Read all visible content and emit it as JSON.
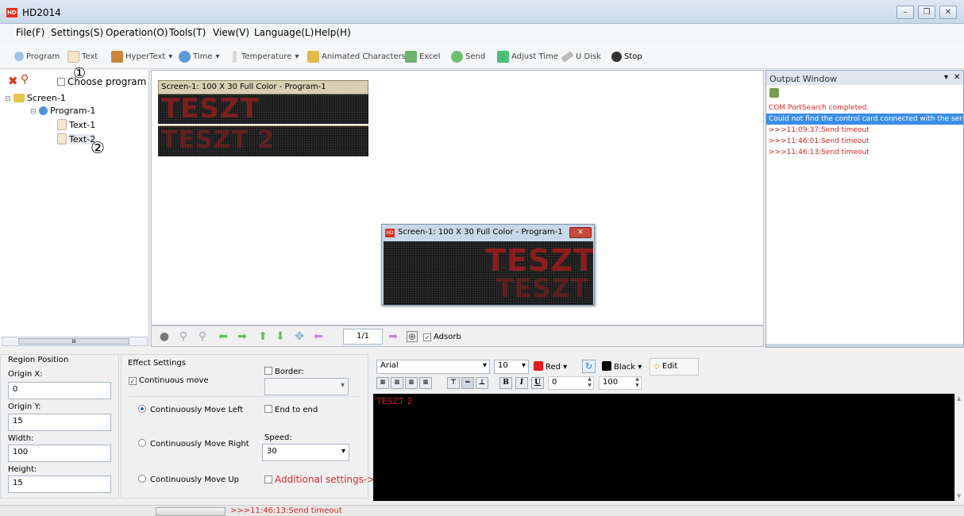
{
  "app": {
    "title": "HD2014"
  },
  "menu": [
    "File(F)",
    "Settings(S)",
    "Operation(O)",
    "Tools(T)",
    "View(V)",
    "Language(L)",
    "Help(H)"
  ],
  "toolbar": {
    "program": "Program",
    "text": "Text",
    "hypertext": "HyperText",
    "time": "Time",
    "temperature": "Temperature",
    "animated": "Animated Characters",
    "excel": "Excel",
    "send": "Send",
    "adjust_time": "Adjust Time",
    "udisk": "U Disk",
    "stop": "Stop"
  },
  "tree": {
    "choose_program": "Choose program",
    "screen": "Screen-1",
    "program": "Program-1",
    "text1": "Text-1",
    "text2": "Text-2",
    "marker1": "①",
    "marker2": "②",
    "scroll_mark": "III"
  },
  "canvas": {
    "screen_title": "Screen-1: 100 X 30 Full Color - Program-1",
    "led1": "TESZT",
    "led2": "TESZT 2",
    "preview_title": "Screen-1: 100 X 30 Full Color - Program-1",
    "page": "1/1",
    "adsorb": "Adsorb"
  },
  "output": {
    "title": "Output Window",
    "lines": [
      "COM PortSearch completed.",
      "Could not find the control card connected with the serial p",
      ">>>11:09:37:Send timeout",
      ">>>11:46:01:Send timeout",
      ">>>11:46:13:Send timeout"
    ]
  },
  "region": {
    "title": "Region Position",
    "origin_x_label": "Origin X:",
    "origin_x": "0",
    "origin_y_label": "Origin Y:",
    "origin_y": "15",
    "width_label": "Width:",
    "width": "100",
    "height_label": "Height:",
    "height": "15"
  },
  "effect": {
    "title": "Effect Settings",
    "continuous_move": "Continuous move",
    "border": "Border:",
    "move_left": "Continuously Move Left",
    "end_to_end": "End to end",
    "move_right": "Continuously Move Right",
    "speed_label": "Speed:",
    "speed": "30",
    "move_up": "Continuously Move Up",
    "additional": "Additional settings->"
  },
  "editor": {
    "font": "Arial",
    "size": "10",
    "color": "Red",
    "bg_color": "Black",
    "edit": "Edit",
    "spacing": "0",
    "percent": "100",
    "content": "TESZT 2",
    "bold": "B",
    "italic": "I",
    "underline": "U"
  },
  "status": {
    "message": ">>>11:46:13:Send timeout"
  }
}
